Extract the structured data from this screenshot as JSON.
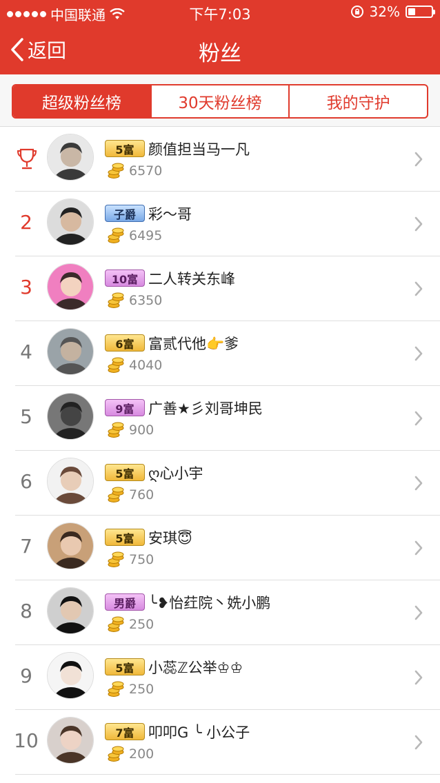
{
  "status_bar": {
    "carrier": "中国联通",
    "time": "下午7:03",
    "battery": "32%",
    "battery_level": 0.32
  },
  "nav": {
    "back_label": "返回",
    "title": "粉丝"
  },
  "tabs": [
    {
      "label": "超级粉丝榜",
      "active": true
    },
    {
      "label": "30天粉丝榜",
      "active": false
    },
    {
      "label": "我的守护",
      "active": false
    }
  ],
  "fans": [
    {
      "rank": "",
      "badge": "5富",
      "badge_color": "gold",
      "name": "颜值担当马一凡",
      "score": "6570"
    },
    {
      "rank": "2",
      "badge": "子爵",
      "badge_color": "blue",
      "name": "彩～哥",
      "score": "6495"
    },
    {
      "rank": "3",
      "badge": "10富",
      "badge_color": "purple",
      "name": "二人转关东峰",
      "score": "6350"
    },
    {
      "rank": "4",
      "badge": "6富",
      "badge_color": "gold",
      "name": "富贰代他👉爹",
      "score": "4040"
    },
    {
      "rank": "5",
      "badge": "9富",
      "badge_color": "purple",
      "name": "广善★彡刘哥坤民",
      "score": "900"
    },
    {
      "rank": "6",
      "badge": "5富",
      "badge_color": "gold",
      "name": "ღ心小宇",
      "score": "760"
    },
    {
      "rank": "7",
      "badge": "5富",
      "badge_color": "gold",
      "name": "安琪😇",
      "score": "750"
    },
    {
      "rank": "8",
      "badge": "男爵",
      "badge_color": "purple",
      "name": "╰❥怡荭院丶姺小鹏",
      "score": "250"
    },
    {
      "rank": "9",
      "badge": "5富",
      "badge_color": "gold",
      "name": "小蕊ℤ公举♔♔",
      "score": "250"
    },
    {
      "rank": "10",
      "badge": "7富",
      "badge_color": "gold",
      "name": "叩叩G ╰ 小公子",
      "score": "200"
    }
  ]
}
